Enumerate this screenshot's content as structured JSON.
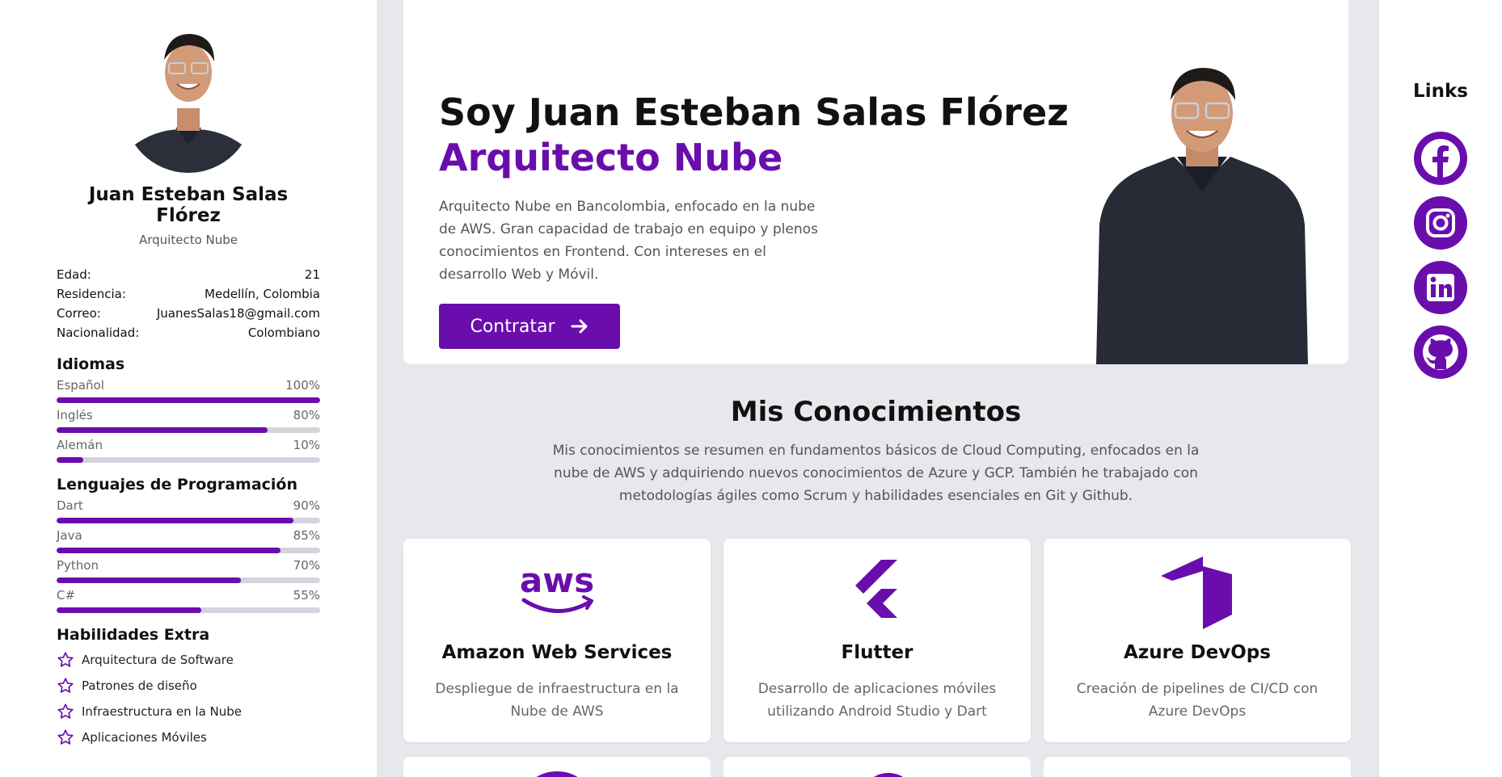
{
  "colors": {
    "accent": "#6a0dad",
    "track": "#d4d4dc",
    "page_bg": "#e7e7ec"
  },
  "sidebar": {
    "name": "Juan Esteban Salas Flórez",
    "role": "Arquitecto Nube",
    "info": [
      {
        "label": "Edad:",
        "value": "21"
      },
      {
        "label": "Residencia:",
        "value": "Medellín, Colombia"
      },
      {
        "label": "Correo:",
        "value": "JuanesSalas18@gmail.com"
      },
      {
        "label": "Nacionalidad:",
        "value": "Colombiano"
      }
    ],
    "languages_title": "Idiomas",
    "languages": [
      {
        "name": "Español",
        "percent_label": "100%",
        "level": 100
      },
      {
        "name": "Inglés",
        "percent_label": "80%",
        "level": 80
      },
      {
        "name": "Alemán",
        "percent_label": "10%",
        "level": 10
      }
    ],
    "programming_title": "Lenguajes de Programación",
    "programming": [
      {
        "name": "Dart",
        "percent_label": "90%",
        "level": 90
      },
      {
        "name": "Java",
        "percent_label": "85%",
        "level": 85
      },
      {
        "name": "Python",
        "percent_label": "70%",
        "level": 70
      },
      {
        "name": "C#",
        "percent_label": "55%",
        "level": 55
      }
    ],
    "extra_title": "Habilidades Extra",
    "extra_icon": "star-outline-icon",
    "extra": [
      "Arquitectura de Software",
      "Patrones de diseño",
      "Infraestructura en la Nube",
      "Aplicaciones Móviles"
    ]
  },
  "hero": {
    "title": "Soy Juan Esteban Salas Flórez",
    "subtitle": "Arquitecto Nube",
    "description": "Arquitecto Nube en Bancolombia, enfocado en la nube de AWS. Gran capacidad de trabajo en equipo y plenos conocimientos en Frontend. Con intereses en el desarrollo Web y Móvil.",
    "button_label": "Contratar",
    "button_icon": "arrow-right-icon"
  },
  "knowledge": {
    "title": "Mis Conocimientos",
    "description": "Mis conocimientos se resumen en fundamentos básicos de Cloud Computing, enfocados en la nube de AWS y adquiriendo nuevos conocimientos de Azure y GCP. También he trabajado con metodologías ágiles como Scrum y habilidades esenciales en Git y Github.",
    "cards": [
      {
        "icon": "aws-logo-icon",
        "title": "Amazon Web Services",
        "description": "Despliegue de infraestructura en la Nube de AWS"
      },
      {
        "icon": "flutter-logo-icon",
        "title": "Flutter",
        "description": "Desarrollo de aplicaciones móviles utilizando Android Studio y Dart"
      },
      {
        "icon": "azure-devops-logo-icon",
        "title": "Azure DevOps",
        "description": "Creación de pipelines de CI/CD con Azure DevOps"
      }
    ]
  },
  "links": {
    "title": "Links",
    "items": [
      {
        "icon": "facebook-icon"
      },
      {
        "icon": "instagram-icon"
      },
      {
        "icon": "linkedin-icon"
      },
      {
        "icon": "github-icon"
      }
    ]
  }
}
